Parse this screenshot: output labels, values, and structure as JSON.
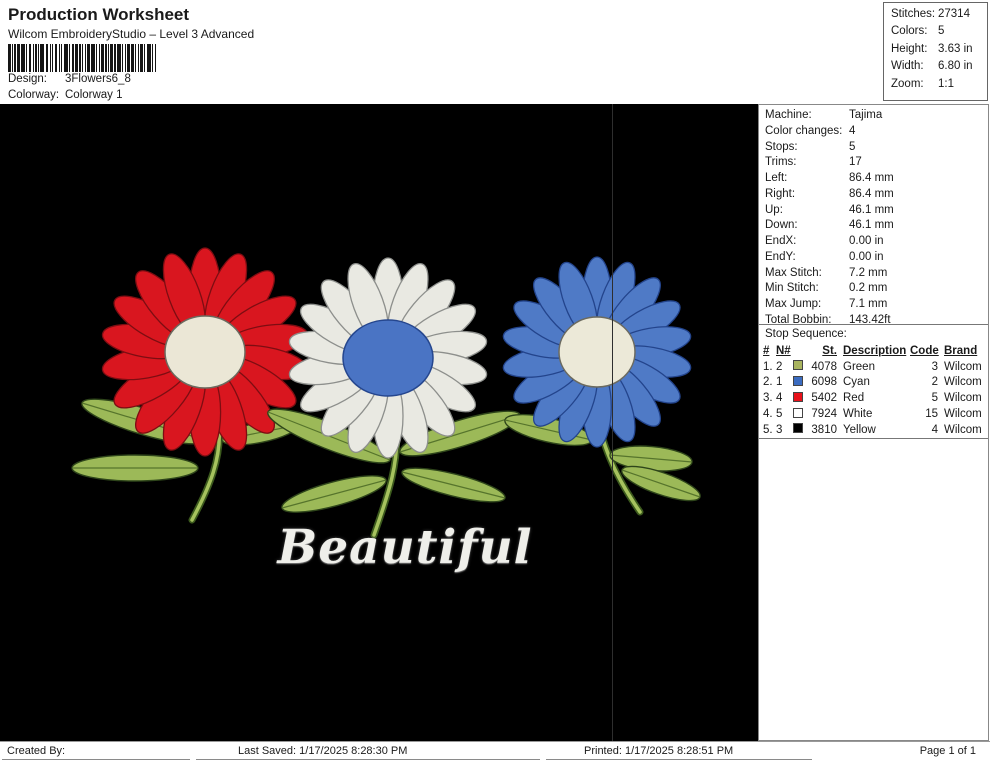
{
  "header": {
    "title": "Production Worksheet",
    "subtitle": "Wilcom EmbroideryStudio – Level 3 Advanced",
    "design": {
      "label": "Design:",
      "value": "3Flowers6_8"
    },
    "colorway": {
      "label": "Colorway:",
      "value": "Colorway 1"
    }
  },
  "summary": {
    "rows": [
      {
        "label": "Stitches:",
        "value": "27314"
      },
      {
        "label": "Colors:",
        "value": "5"
      },
      {
        "label": "Height:",
        "value": "3.63 in"
      },
      {
        "label": "Width:",
        "value": "6.80 in"
      },
      {
        "label": "Zoom:",
        "value": "1:1"
      }
    ]
  },
  "machine_info": {
    "rows": [
      {
        "label": "Machine:",
        "value": "Tajima"
      },
      {
        "label": "Color changes:",
        "value": "4"
      },
      {
        "label": "Stops:",
        "value": "5"
      },
      {
        "label": "Trims:",
        "value": "17"
      },
      {
        "label": "Left:",
        "value": "86.4 mm"
      },
      {
        "label": "Right:",
        "value": "86.4 mm"
      },
      {
        "label": "Up:",
        "value": "46.1 mm"
      },
      {
        "label": "Down:",
        "value": "46.1 mm"
      },
      {
        "label": "EndX:",
        "value": "0.00 in"
      },
      {
        "label": "EndY:",
        "value": "0.00 in"
      },
      {
        "label": "Max Stitch:",
        "value": "7.2 mm"
      },
      {
        "label": "Min Stitch:",
        "value": "0.2 mm"
      },
      {
        "label": "Max Jump:",
        "value": "7.1 mm"
      },
      {
        "label": "Total Bobbin:",
        "value": "143.42ft"
      }
    ]
  },
  "stop_sequence": {
    "title": "Stop Sequence:",
    "columns": [
      "#",
      "N#",
      "St.",
      "Description",
      "Code",
      "Brand"
    ],
    "rows": [
      {
        "num": "1.",
        "needle": "2",
        "swatch": "#a9b45f",
        "st": "4078",
        "description": "Green",
        "code": "3",
        "brand": "Wilcom"
      },
      {
        "num": "2.",
        "needle": "1",
        "swatch": "#3a6bc0",
        "st": "6098",
        "description": "Cyan",
        "code": "2",
        "brand": "Wilcom"
      },
      {
        "num": "3.",
        "needle": "4",
        "swatch": "#e8111a",
        "st": "5402",
        "description": "Red",
        "code": "5",
        "brand": "Wilcom"
      },
      {
        "num": "4.",
        "needle": "5",
        "swatch": "#ffffff",
        "st": "7924",
        "description": "White",
        "code": "15",
        "brand": "Wilcom"
      },
      {
        "num": "5.",
        "needle": "3",
        "swatch": "#000000",
        "st": "3810",
        "description": "Yellow",
        "code": "4",
        "brand": "Wilcom"
      }
    ]
  },
  "design_preview": {
    "caption": "Beautiful",
    "background": "#000000",
    "flowers": [
      {
        "name": "red-daisy",
        "petal": "#d9161f",
        "petal_outline": "#7d0d12",
        "center": "#ebe7d6",
        "center_outline": "#6b6a5f"
      },
      {
        "name": "white-daisy",
        "petal": "#e9e9e2",
        "petal_outline": "#8d8f8c",
        "center": "#4a74c4",
        "center_outline": "#25468e"
      },
      {
        "name": "blue-daisy",
        "petal": "#4f7ac6",
        "petal_outline": "#23448c",
        "center": "#ece9d8",
        "center_outline": "#6b6a5f"
      }
    ],
    "foliage": {
      "leaf": "#9cb958",
      "leaf_outline": "#2e451a",
      "stem": "#a6c25e",
      "stem_outline": "#3c5a1d",
      "vein": "#56742c"
    }
  },
  "footer": {
    "created_by": "Created By:",
    "last_saved": "Last Saved: 1/17/2025 8:28:30 PM",
    "printed": "Printed: 1/17/2025 8:28:51 PM",
    "page": "Page 1 of 1"
  }
}
